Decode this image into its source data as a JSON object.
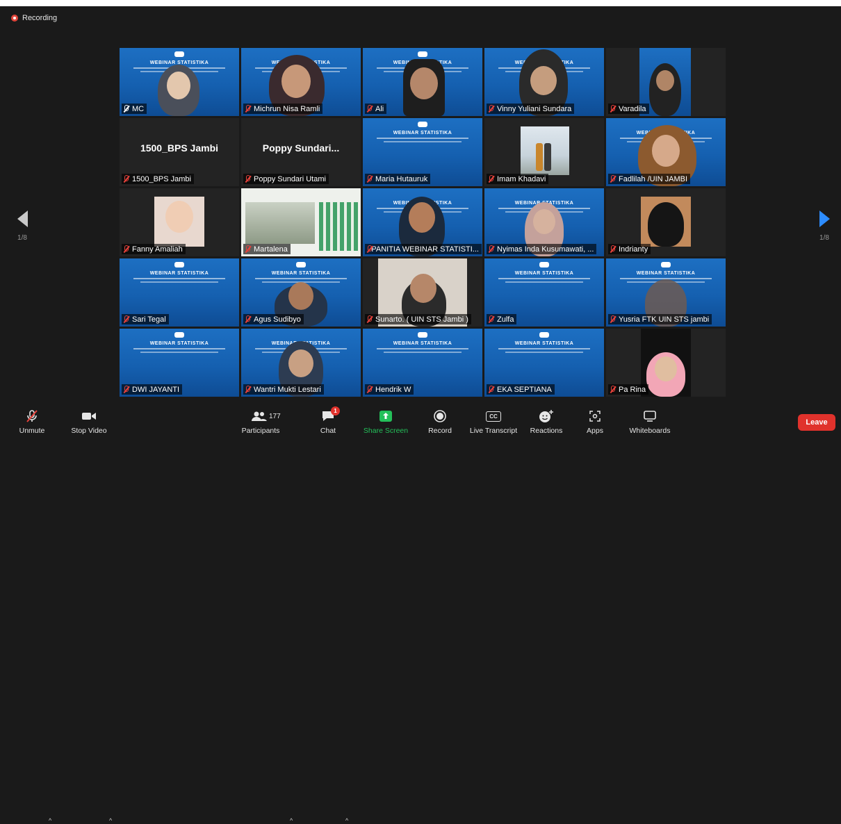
{
  "recording": {
    "label": "Recording"
  },
  "pagination": {
    "left": "1/8",
    "right": "1/8"
  },
  "banner": {
    "title": "WEBINAR STATISTIKA"
  },
  "tiles": [
    {
      "name": "MC",
      "placeholder": ""
    },
    {
      "name": "Michrun Nisa Ramli",
      "placeholder": ""
    },
    {
      "name": "Ali",
      "placeholder": ""
    },
    {
      "name": "Vinny Yuliani Sundara",
      "placeholder": ""
    },
    {
      "name": "Varadila",
      "placeholder": ""
    },
    {
      "name": "1500_BPS Jambi",
      "placeholder": "1500_BPS Jambi"
    },
    {
      "name": "Poppy Sundari Utami",
      "placeholder": "Poppy  Sundari..."
    },
    {
      "name": "Maria Hutauruk",
      "placeholder": ""
    },
    {
      "name": "Imam Khadavi",
      "placeholder": ""
    },
    {
      "name": "Fadlilah /UIN JAMBI",
      "placeholder": ""
    },
    {
      "name": "Fanny Amaliah",
      "placeholder": ""
    },
    {
      "name": "Martalena",
      "placeholder": ""
    },
    {
      "name": "PANITIA WEBINAR STATISTI...",
      "placeholder": ""
    },
    {
      "name": "Nyimas Inda Kusumawati, ...",
      "placeholder": ""
    },
    {
      "name": "Indrianty",
      "placeholder": ""
    },
    {
      "name": "Sari Tegal",
      "placeholder": ""
    },
    {
      "name": "Agus Sudibyo",
      "placeholder": ""
    },
    {
      "name": "Sunarto. ( UIN STS Jambi )",
      "placeholder": ""
    },
    {
      "name": "Zulfa",
      "placeholder": ""
    },
    {
      "name": "Yusria FTK UIN STS jambi",
      "placeholder": ""
    },
    {
      "name": "DWI JAYANTI",
      "placeholder": ""
    },
    {
      "name": "Wantri Mukti Lestari",
      "placeholder": ""
    },
    {
      "name": "Hendrik W",
      "placeholder": ""
    },
    {
      "name": "EKA SEPTIANA",
      "placeholder": ""
    },
    {
      "name": "Pa Rina",
      "placeholder": ""
    }
  ],
  "toolbar": {
    "unmute": "Unmute",
    "stop_video": "Stop Video",
    "participants": "Participants",
    "participants_count": "177",
    "chat": "Chat",
    "chat_badge": "1",
    "share_screen": "Share Screen",
    "record": "Record",
    "live_transcript": "Live Transcript",
    "cc": "CC",
    "reactions": "Reactions",
    "apps": "Apps",
    "whiteboards": "Whiteboards",
    "leave": "Leave"
  },
  "colors": {
    "accent_green": "#24c05a",
    "leave_red": "#e0322c",
    "speaker_outline": "#d7e35a",
    "next_arrow": "#2d8cff"
  }
}
